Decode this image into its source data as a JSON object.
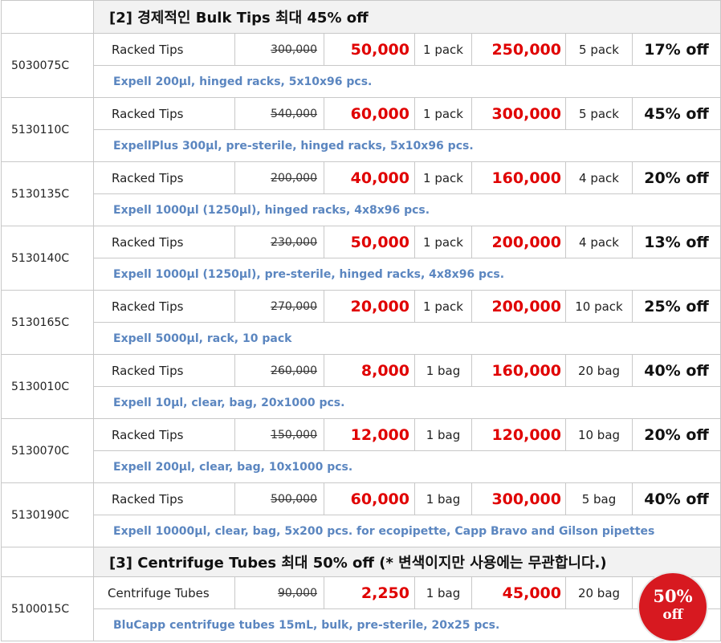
{
  "section2": {
    "title": "[2] 경제적인 Bulk Tips 최대 45% off"
  },
  "section3": {
    "title": "[3] Centrifuge Tubes 최대 50% off  (* 변색이지만 사용에는 무관합니다.)"
  },
  "products": [
    {
      "code": "5030075C",
      "name": "Racked Tips",
      "original_price": "300,000",
      "price": "50,000",
      "unit": "1 pack",
      "bulk_price": "250,000",
      "bulk_unit": "5 pack",
      "discount": "17% off",
      "description": "Expell 200µl, hinged racks, 5x10x96 pcs."
    },
    {
      "code": "5130110C",
      "name": "Racked Tips",
      "original_price": "540,000",
      "price": "60,000",
      "unit": "1 pack",
      "bulk_price": "300,000",
      "bulk_unit": "5 pack",
      "discount": "45% off",
      "description": "ExpellPlus 300µl, pre-sterile, hinged racks, 5x10x96 pcs."
    },
    {
      "code": "5130135C",
      "name": "Racked Tips",
      "original_price": "200,000",
      "price": "40,000",
      "unit": "1 pack",
      "bulk_price": "160,000",
      "bulk_unit": "4 pack",
      "discount": "20% off",
      "description": "Expell 1000µl (1250µl), hinged racks, 4x8x96 pcs."
    },
    {
      "code": "5130140C",
      "name": "Racked Tips",
      "original_price": "230,000",
      "price": "50,000",
      "unit": "1 pack",
      "bulk_price": "200,000",
      "bulk_unit": "4 pack",
      "discount": "13% off",
      "description": "Expell 1000µl (1250µl),  pre-sterile, hinged racks, 4x8x96 pcs."
    },
    {
      "code": "5130165C",
      "name": "Racked Tips",
      "original_price": "270,000",
      "price": "20,000",
      "unit": "1 pack",
      "bulk_price": "200,000",
      "bulk_unit": "10 pack",
      "discount": "25% off",
      "description": "Expell 5000µl, rack, 10 pack"
    },
    {
      "code": "5130010C",
      "name": "Racked Tips",
      "original_price": "260,000",
      "price": "8,000",
      "unit": "1 bag",
      "bulk_price": "160,000",
      "bulk_unit": "20 bag",
      "discount": "40% off",
      "description": "Expell 10µl, clear, bag, 20x1000 pcs."
    },
    {
      "code": "5130070C",
      "name": "Racked Tips",
      "original_price": "150,000",
      "price": "12,000",
      "unit": "1 bag",
      "bulk_price": "120,000",
      "bulk_unit": "10 bag",
      "discount": "20% off",
      "description": "Expell 200µl, clear, bag, 10x1000 pcs."
    },
    {
      "code": "5130190C",
      "name": "Racked Tips",
      "original_price": "500,000",
      "price": "60,000",
      "unit": "1 bag",
      "bulk_price": "300,000",
      "bulk_unit": "5 bag",
      "discount": "40% off",
      "description": "Expell 10000µl, clear, bag, 5x200 pcs. for ecopipette, Capp Bravo and Gilson pipettes"
    }
  ],
  "tube": {
    "code": "5100015C",
    "name": "Centrifuge Tubes",
    "original_price": "90,000",
    "price": "2,250",
    "unit": "1 bag",
    "bulk_price": "45,000",
    "bulk_unit": "20 bag",
    "description": "BluCapp centrifuge tubes 15mL, bulk, pre-sterile, 20x25 pcs."
  },
  "badge": {
    "line1": "50%",
    "line2": "off"
  },
  "colors": {
    "price_red": "#e00000",
    "description_blue": "#5b86c0",
    "badge_red": "#d71920",
    "header_gray": "#f2f2f2"
  }
}
